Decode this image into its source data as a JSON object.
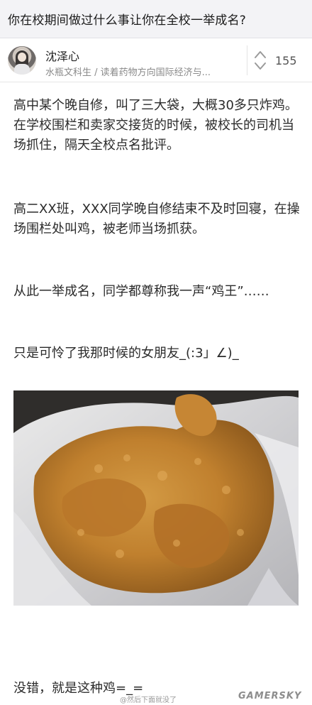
{
  "question": {
    "title": "你在校期间做过什么事让你在全校一举成名?"
  },
  "author": {
    "name": "沈泽心",
    "bio": "水瓶文科生 / 读着药物方向国际经济与...",
    "vote_count": "155"
  },
  "answer": {
    "paragraphs": [
      "高中某个晚自修，叫了三大袋，大概30多只炸鸡。在学校围栏和卖家交接货的时候，被校长的司机当场抓住，隔天全校点名批评。",
      "高二XX班，XXX同学晚自修结束不及时回寝，在操场围栏处叫鸡，被老师当场抓获。",
      "从此一举成名，同学都尊称我一声“鸡王”……",
      "只是可怜了我那时候的女朋友_(:3」∠)_"
    ],
    "closing": "没错，就是这种鸡=_="
  },
  "watermark": {
    "weibo_text": "@然后下面就没了",
    "brand": "GAMERSKY"
  },
  "icons": {
    "vote": "vote-arrows-icon",
    "avatar": "avatar-photo",
    "photo": "fried-chicken-photo"
  },
  "colors": {
    "question_bar_bg": "#f3f3f6",
    "body_text": "#2b2b2b",
    "secondary_text": "#8a8a8a"
  }
}
